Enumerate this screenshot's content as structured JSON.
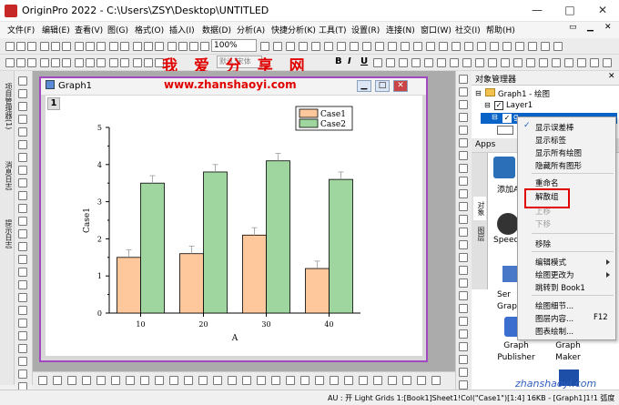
{
  "app": {
    "title": "OriginPro 2022 - C:\\Users\\ZSY\\Desktop\\UNTITLED"
  },
  "window_controls": {
    "minimize": "—",
    "maximize": "□",
    "close": "✕"
  },
  "menu": [
    "文件(F)",
    "编辑(E)",
    "查看(V)",
    "图(G)",
    "格式(O)",
    "插入(I)",
    "数据(D)",
    "分析(A)",
    "快捷分析(K)",
    "工具(T)",
    "设置(R)",
    "连接(N)",
    "窗口(W)",
    "社交(I)",
    "帮助(H)"
  ],
  "toolbar": {
    "zoom": "100%",
    "font_placeholder": "默认:宋体",
    "bold": "B",
    "italic": "I",
    "underline": "U"
  },
  "overlay": {
    "brand": "我 爱 分 享 网",
    "url": "www.zhanshaoyi.com",
    "watermark": "zhanshaoyi.com"
  },
  "left_tabs": [
    "项目管理器(1)",
    "消息日志",
    "提示日志"
  ],
  "graph": {
    "title": "Graph1",
    "layer": "1"
  },
  "chart_data": {
    "type": "bar",
    "xlabel": "A",
    "ylabel": "Case1",
    "categories": [
      "10",
      "20",
      "30",
      "40"
    ],
    "ylim": [
      0,
      5
    ],
    "yticks": [
      "0",
      "1",
      "2",
      "3",
      "4",
      "5"
    ],
    "series": [
      {
        "name": "Case1",
        "values": [
          1.5,
          1.6,
          2.1,
          1.2
        ],
        "errors": [
          0.2,
          0.2,
          0.2,
          0.2
        ],
        "color": "#ffc79c"
      },
      {
        "name": "Case2",
        "values": [
          3.5,
          3.8,
          4.1,
          3.6
        ],
        "errors": [
          0.2,
          0.2,
          0.2,
          0.2
        ],
        "color": "#9fd59f"
      }
    ],
    "legend": "top-right"
  },
  "object_manager": {
    "title": "对象管理器",
    "tree": [
      "Graph1 - 绘图",
      "Layer1",
      "g"
    ]
  },
  "apps": {
    "title": "Apps",
    "vtabs": [
      "对象",
      "图层"
    ],
    "items": [
      "添加A",
      "Speed",
      "Ser Graph",
      "Graph Publisher",
      "Graph Maker"
    ]
  },
  "context_menu": {
    "items": [
      {
        "label": "显示误差棒",
        "checked": true
      },
      {
        "label": "显示标签"
      },
      {
        "label": "显示所有绘图"
      },
      {
        "label": "隐藏所有图形"
      },
      {
        "label": "重命名"
      },
      {
        "label": "解散组",
        "highlight": true
      },
      {
        "label": "上移",
        "disabled": true
      },
      {
        "label": "下移",
        "disabled": true
      },
      {
        "label": "移除"
      },
      {
        "label": "编辑模式",
        "submenu": true
      },
      {
        "label": "绘图更改为",
        "submenu": true
      },
      {
        "label": "跳转到 Book1"
      },
      {
        "label": "绘图细节..."
      },
      {
        "label": "图层内容...",
        "shortcut": "F12"
      },
      {
        "label": "图表绘制..."
      }
    ]
  },
  "status": {
    "text": "AU : 开  Light Grids  1:[Book1]Sheet1!Col(\"Case1\")[1:4]  16KB - [Graph1]1!1  弧度"
  }
}
